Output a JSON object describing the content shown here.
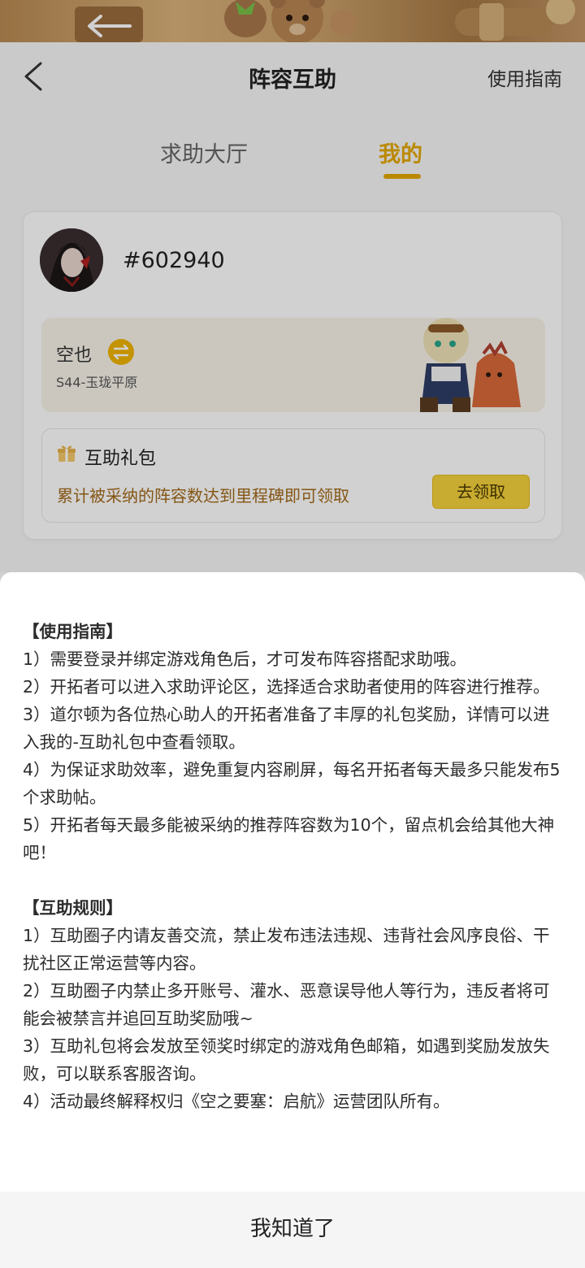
{
  "header": {
    "title": "阵容互助",
    "guide_link": "使用指南"
  },
  "tabs": [
    {
      "label": "求助大厅",
      "active": false
    },
    {
      "label": "我的",
      "active": true
    }
  ],
  "profile": {
    "user_id": "#602940",
    "role_name": "空也",
    "server": "S44-玉珑平原"
  },
  "gift": {
    "title": "互助礼包",
    "description": "累计被采纳的阵容数达到里程碑即可领取",
    "claim_label": "去领取"
  },
  "sheet": {
    "guide_title": "【使用指南】",
    "guide_items": [
      "1）需要登录并绑定游戏角色后，才可发布阵容搭配求助哦。",
      "2）开拓者可以进入求助评论区，选择适合求助者使用的阵容进行推荐。",
      "3）道尔顿为各位热心助人的开拓者准备了丰厚的礼包奖励，详情可以进入我的-互助礼包中查看领取。",
      "4）为保证求助效率，避免重复内容刷屏，每名开拓者每天最多只能发布5个求助帖。",
      "5）开拓者每天最多能被采纳的推荐阵容数为10个，留点机会给其他大神吧！"
    ],
    "rules_title": "【互助规则】",
    "rules_items": [
      "1）互助圈子内请友善交流，禁止发布违法违规、违背社会风序良俗、干扰社区正常运营等内容。",
      "2）互助圈子内禁止多开账号、灌水、恶意误导他人等行为，违反者将可能会被禁言并追回互助奖励哦~",
      "3）互助礼包将会发放至领奖时绑定的游戏角色邮箱，如遇到奖励发放失败，可以联系客服咨询。",
      "4）活动最终解释权归《空之要塞：启航》运营团队所有。"
    ],
    "ack_label": "我知道了"
  },
  "colors": {
    "accent": "#e4a800",
    "button_yellow": "#f5d13c",
    "gift_text": "#a36a1a"
  }
}
